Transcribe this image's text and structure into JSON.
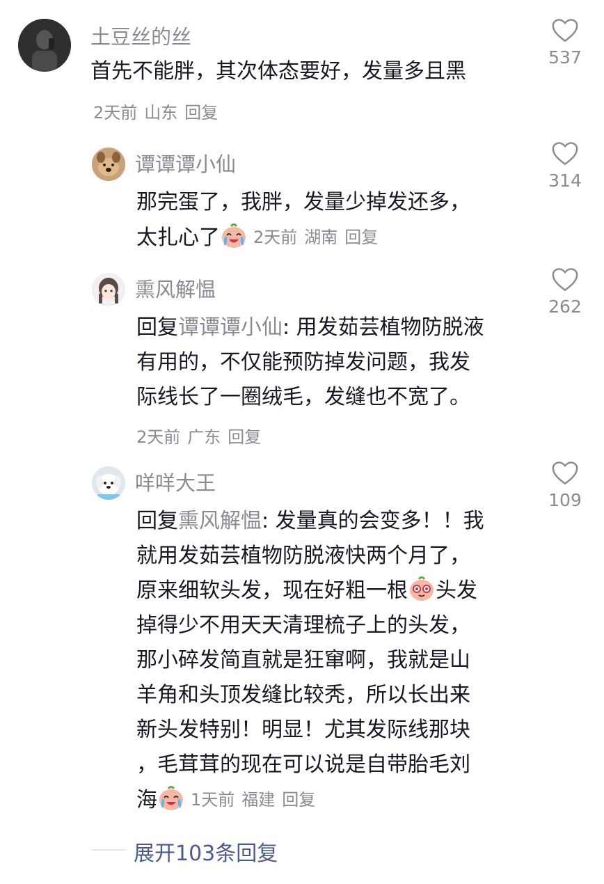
{
  "comments": [
    {
      "username": "土豆丝的丝",
      "lines": [
        "首先不能胖，其次体态要好，发量多且黑"
      ],
      "time": "2天前",
      "location": "山东",
      "reply": "回复",
      "likes": "537",
      "avatar_icon": "dark-selfie-avatar"
    }
  ],
  "replies": [
    {
      "username": "谭谭谭小仙",
      "lines": [
        "那完蛋了，我胖，发量少掉发还多，",
        "太扎心了"
      ],
      "time": "2天前",
      "location": "湖南",
      "reply": "回复",
      "likes": "314",
      "avatar_icon": "dog-avatar",
      "emoji_icon": "crying-laugh-emoji"
    },
    {
      "username": "熏风解愠",
      "reply_prefix": "回复",
      "mention": "谭谭谭小仙",
      "lines": [
        ": 用发茹芸植物防脱液",
        "有用的，不仅能预防掉发问题，我发",
        "际线长了一圈绒毛，发缝也不宽了。"
      ],
      "time": "2天前",
      "location": "广东",
      "reply": "回复",
      "likes": "262",
      "avatar_icon": "anime-girl-avatar"
    },
    {
      "username": "咩咩大王",
      "reply_prefix": "回复",
      "mention": "熏风解愠",
      "lines": [
        ": 发量真的会变多！！我",
        "就用发茹芸植物防脱液快两个月了，",
        "原来细软头发，现在好粗一根",
        "头发",
        "掉得少不用天天清理梳子上的头发，",
        "那小碎发简直就是狂窜啊，我就是山",
        "羊角和头顶发缝比较秃，所以长出来",
        "新头发特别！明显！尤其发际线那块",
        "，毛茸茸的现在可以说是自带胎毛刘",
        "海"
      ],
      "time": "1天前",
      "location": "福建",
      "reply": "回复",
      "likes": "109",
      "avatar_icon": "white-dog-avatar",
      "emoji_icons": [
        "starry-eyes-emoji",
        "crying-laugh-emoji"
      ]
    }
  ],
  "expand": "展开103条回复",
  "colors": {
    "text": "#161823",
    "meta": "#8a8b91",
    "link": "#4a5a8a"
  }
}
